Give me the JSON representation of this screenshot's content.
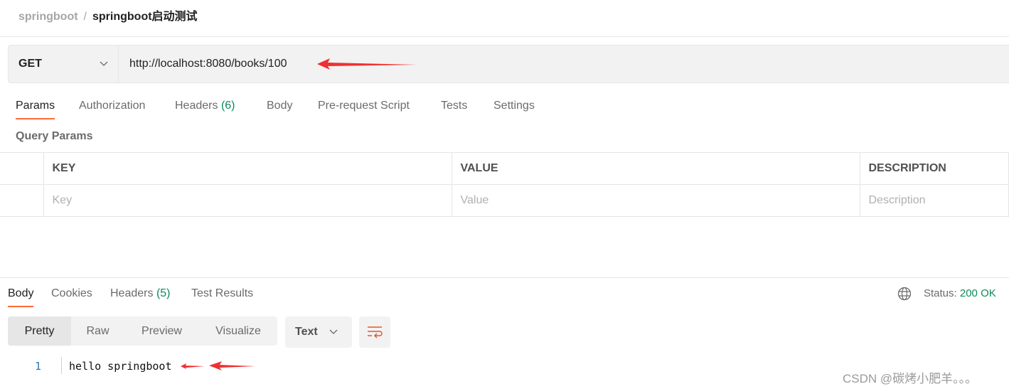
{
  "breadcrumb": {
    "collection": "springboot",
    "separator": "/",
    "request": "springboot启动测试"
  },
  "request": {
    "method": "GET",
    "url": "http://localhost:8080/books/100"
  },
  "request_tabs": [
    {
      "label": "Params"
    },
    {
      "label": "Authorization"
    },
    {
      "label": "Headers",
      "count": "(6)"
    },
    {
      "label": "Body"
    },
    {
      "label": "Pre-request Script"
    },
    {
      "label": "Tests"
    },
    {
      "label": "Settings"
    }
  ],
  "query_params": {
    "title": "Query Params",
    "headers": [
      "KEY",
      "VALUE",
      "DESCRIPTION"
    ],
    "placeholders": [
      "Key",
      "Value",
      "Description"
    ]
  },
  "response_tabs": [
    {
      "label": "Body"
    },
    {
      "label": "Cookies"
    },
    {
      "label": "Headers",
      "count": "(5)"
    },
    {
      "label": "Test Results"
    }
  ],
  "status": {
    "label": "Status:",
    "value": "200 OK"
  },
  "view_modes": [
    "Pretty",
    "Raw",
    "Preview",
    "Visualize"
  ],
  "format": "Text",
  "response_body": [
    {
      "line": "1",
      "text": "hello springboot"
    }
  ],
  "watermark": "CSDN @碳烤小肥羊。。。",
  "colors": {
    "accent": "#ff6c37",
    "status": "#0b8a5a",
    "arrow": "#f03030"
  }
}
